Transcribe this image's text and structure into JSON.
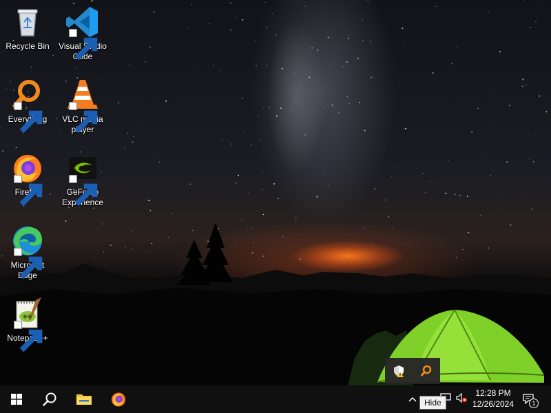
{
  "desktop": {
    "icons": [
      {
        "label": "Recycle Bin",
        "icon": "recycle-bin-icon",
        "shortcut": false
      },
      {
        "label": "Visual Studio Code",
        "icon": "vscode-icon",
        "shortcut": true
      },
      {
        "label": "Everything",
        "icon": "everything-search-icon",
        "shortcut": true
      },
      {
        "label": "VLC media player",
        "icon": "vlc-cone-icon",
        "shortcut": true
      },
      {
        "label": "Firefox",
        "icon": "firefox-icon",
        "shortcut": true
      },
      {
        "label": "GeForce Experience",
        "icon": "nvidia-icon",
        "shortcut": true
      },
      {
        "label": "Microsoft Edge",
        "icon": "edge-icon",
        "shortcut": true
      },
      {
        "label": "Notepad++",
        "icon": "notepad-plus-plus-icon",
        "shortcut": true
      }
    ]
  },
  "tray_flyout": {
    "icons": [
      "security-shield-warning-icon",
      "everything-search-icon"
    ]
  },
  "taskbar": {
    "start": "windows-logo-icon",
    "search": "search-icon",
    "pinned": [
      "file-explorer-icon",
      "firefox-icon"
    ],
    "tray": {
      "chevron": "chevron-up-icon",
      "tooltip": "Hide",
      "icons": [
        "network-icon",
        "volume-muted-icon"
      ],
      "time": "12:28 PM",
      "date": "12/26/2024",
      "notifications": {
        "icon": "notification-center-icon",
        "count": "1"
      }
    }
  },
  "colors": {
    "taskbar": "#101010",
    "flyout": "#262626",
    "accent_orange": "#f08a1c"
  }
}
